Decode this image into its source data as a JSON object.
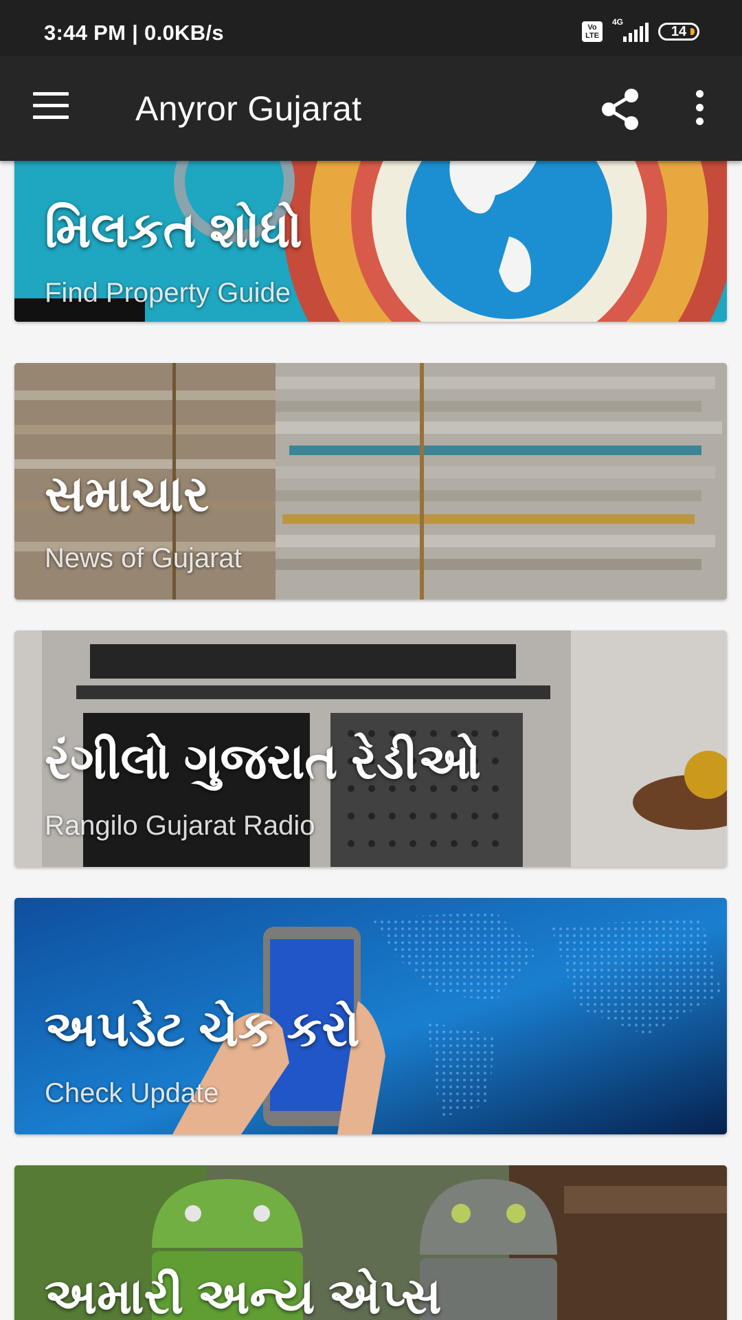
{
  "status_bar": {
    "time": "3:44 PM | 0.0KB/s",
    "volte_label": "Vo LTE",
    "network": "4G",
    "battery": "14"
  },
  "app_bar": {
    "title": "Anyror Gujarat"
  },
  "cards": [
    {
      "title": "મિલકત શોધો",
      "subtitle": "Find Property Guide"
    },
    {
      "title": "સમાચાર",
      "subtitle": "News of Gujarat"
    },
    {
      "title": "રંગીલો ગુજરાત રેડીઓ",
      "subtitle": "Rangilo Gujarat Radio"
    },
    {
      "title": "અપડેટ ચેક કરો",
      "subtitle": "Check Update"
    },
    {
      "title": "અમારી અન્ય એપ્સ",
      "subtitle": ""
    }
  ],
  "colors": {
    "status_bar": "#202020",
    "app_bar": "#262626",
    "background": "#f5f5f5"
  }
}
